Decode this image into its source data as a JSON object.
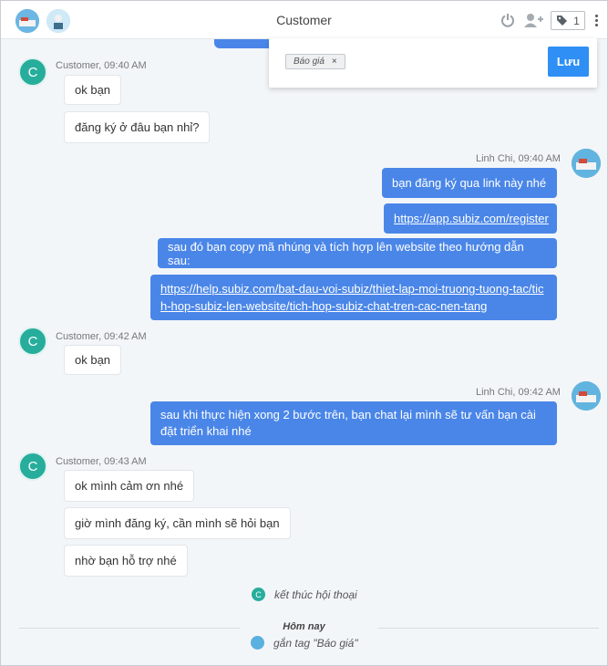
{
  "header": {
    "title": "Customer",
    "tag_count": "1",
    "icons": [
      "power-icon",
      "add-user-icon",
      "tag-icon",
      "more-menu-icon"
    ]
  },
  "tag_popup": {
    "tag_label": "Báo giá",
    "remove_symbol": "×",
    "save_label": "Lưu"
  },
  "messages": [
    {
      "sender": "Customer",
      "time": "Customer, 09:40 AM",
      "texts": [
        "ok bạn",
        "đăng ký ở đâu bạn nhỉ?"
      ]
    },
    {
      "sender": "Linh Chi",
      "time": "Linh Chi, 09:40 AM",
      "texts": [
        "bạn đăng ký qua link này nhé",
        "https://app.subiz.com/register",
        "sau đó bạn copy mã nhúng và tích hợp lên website theo hướng dẫn sau:",
        "https://help.subiz.com/bat-dau-voi-subiz/thiet-lap-moi-truong-tuong-tac/tich-hop-subiz-len-website/tich-hop-subiz-chat-tren-cac-nen-tang"
      ]
    },
    {
      "sender": "Customer",
      "time": "Customer, 09:42 AM",
      "texts": [
        "ok bạn"
      ]
    },
    {
      "sender": "Linh Chi",
      "time": "Linh Chi, 09:42 AM",
      "texts": [
        "sau khi thực hiện xong 2 bước trên, bạn chat lại mình sẽ tư vấn bạn cài đặt triển khai nhé"
      ]
    },
    {
      "sender": "Customer",
      "time": "Customer, 09:43 AM",
      "texts": [
        "ok mình cảm ơn nhé",
        "giờ mình đăng ký, cần mình sẽ hỏi bạn",
        "nhờ bạn hỗ trợ nhé"
      ]
    }
  ],
  "events": {
    "end_conversation": "kết thúc hội thoại",
    "day_label": "Hôm nay",
    "tagged": "gắn tag \"Báo giá\""
  },
  "avatar_letter": "C",
  "colors": {
    "agent_bubble": "#4a86e8",
    "customer_avatar": "#27ad9c",
    "save_button": "#2f8ff4",
    "chat_background": "#f3f6f9"
  }
}
